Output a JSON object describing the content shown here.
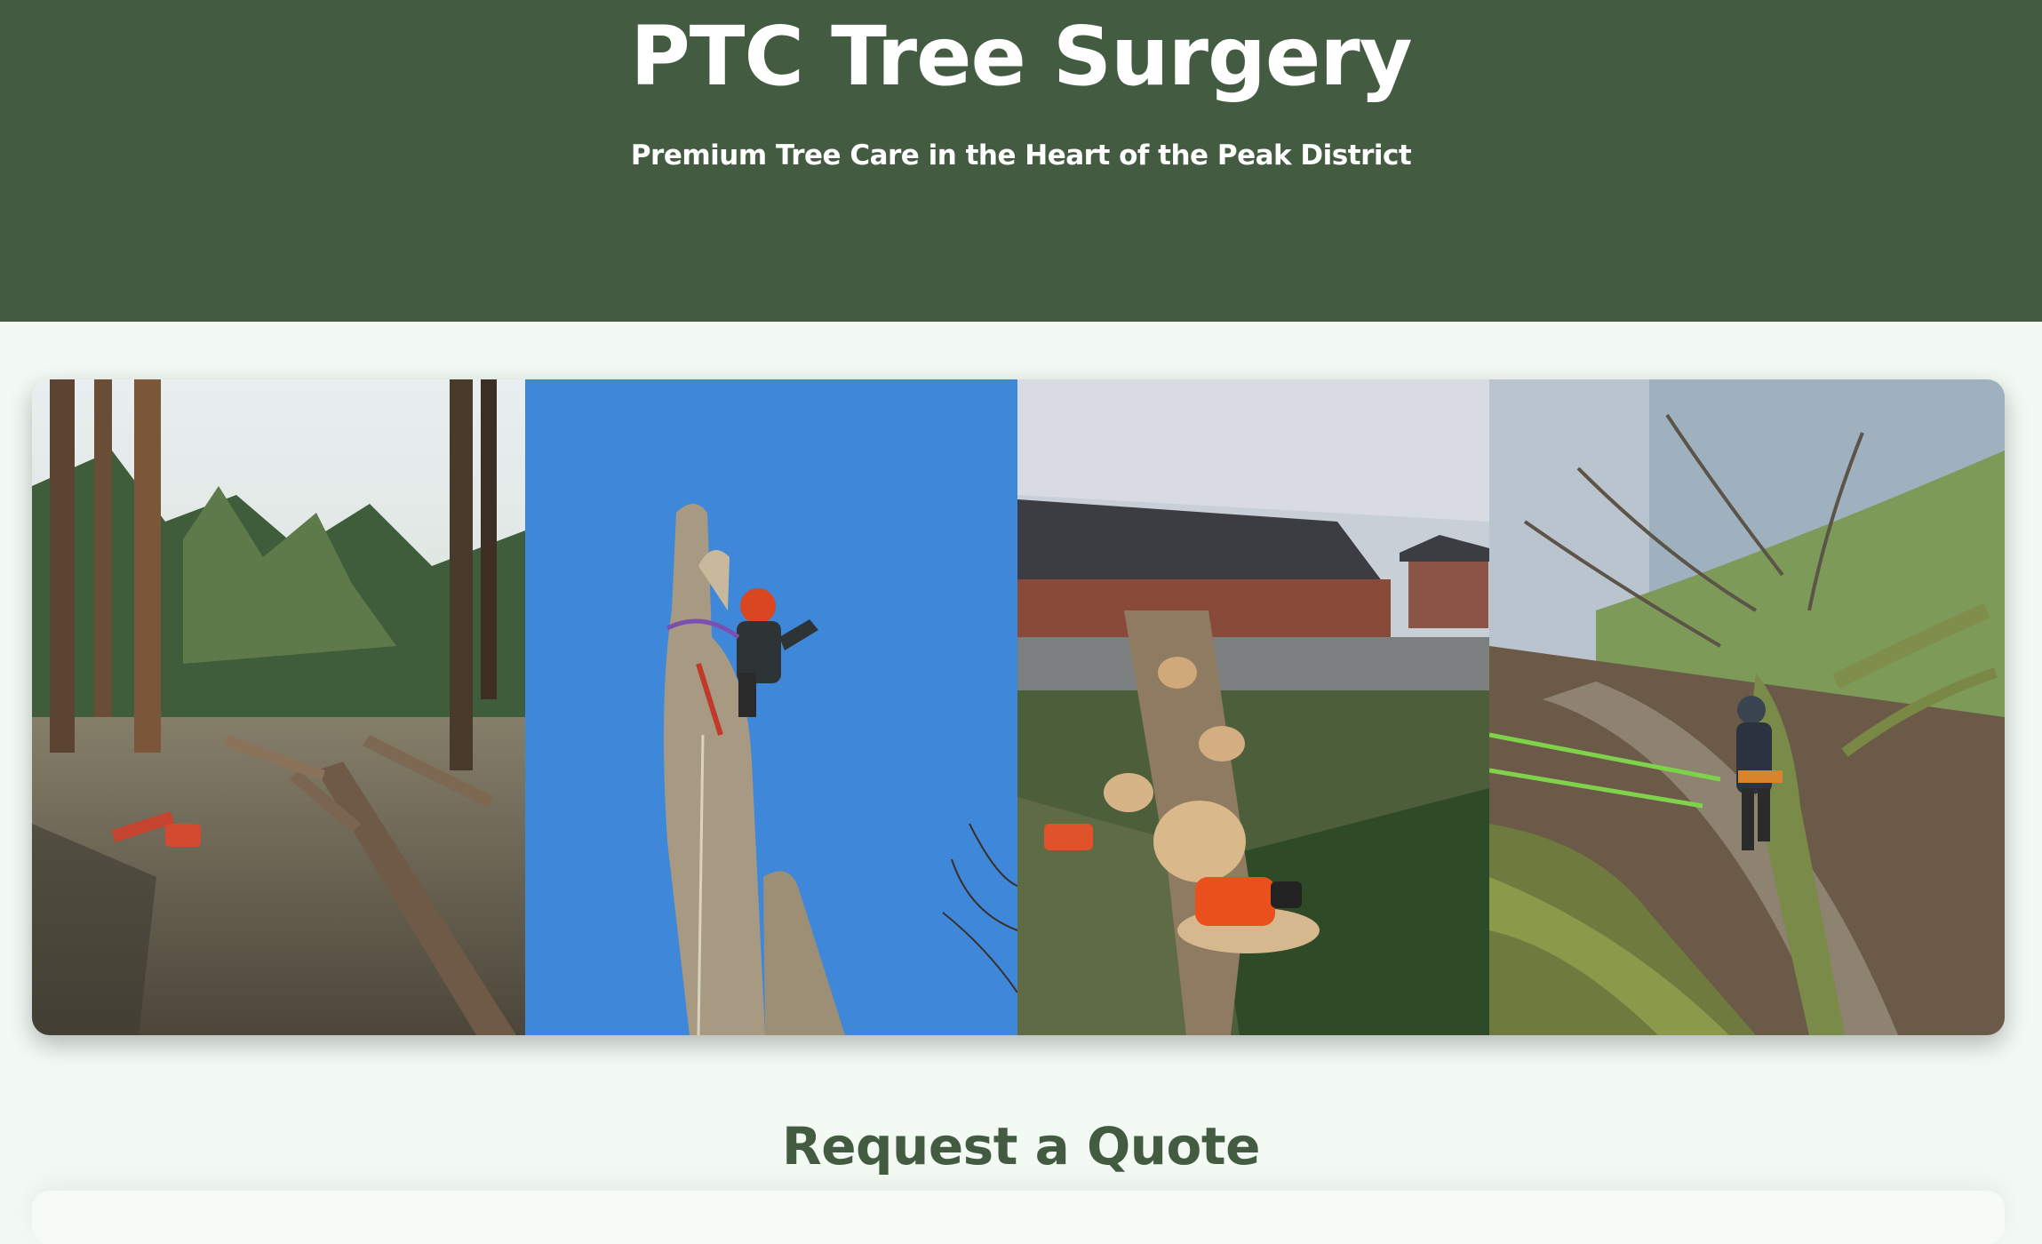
{
  "header": {
    "title": "PTC Tree Surgery",
    "tagline": "Premium Tree Care in the Heart of the Peak District",
    "background_color": "#425b41"
  },
  "gallery": {
    "photos": [
      {
        "subject": "felled-logs-in-pine-forest"
      },
      {
        "subject": "climber-on-tree-trunk-blue-sky"
      },
      {
        "subject": "cut-logs-with-chainsaw-by-bungalow"
      },
      {
        "subject": "climber-roped-in-oak-tree"
      }
    ]
  },
  "quote_section": {
    "title": "Request a Quote",
    "title_color": "#425b41"
  }
}
